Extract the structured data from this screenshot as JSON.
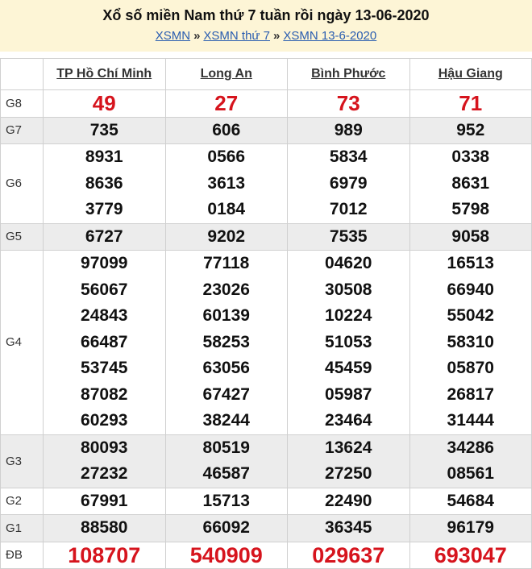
{
  "header": {
    "title": "Xổ số miền Nam thứ 7 tuần rồi ngày 13-06-2020",
    "breadcrumbs": [
      "XSMN",
      "XSMN thứ 7",
      "XSMN 13-6-2020"
    ],
    "separator": "»"
  },
  "table": {
    "provinces": [
      "TP Hồ Chí Minh",
      "Long An",
      "Bình Phước",
      "Hậu Giang"
    ],
    "prizes": [
      {
        "label": "G8",
        "results": [
          [
            "49"
          ],
          [
            "27"
          ],
          [
            "73"
          ],
          [
            "71"
          ]
        ]
      },
      {
        "label": "G7",
        "results": [
          [
            "735"
          ],
          [
            "606"
          ],
          [
            "989"
          ],
          [
            "952"
          ]
        ]
      },
      {
        "label": "G6",
        "results": [
          [
            "8931",
            "8636",
            "3779"
          ],
          [
            "0566",
            "3613",
            "0184"
          ],
          [
            "5834",
            "6979",
            "7012"
          ],
          [
            "0338",
            "8631",
            "5798"
          ]
        ]
      },
      {
        "label": "G5",
        "results": [
          [
            "6727"
          ],
          [
            "9202"
          ],
          [
            "7535"
          ],
          [
            "9058"
          ]
        ]
      },
      {
        "label": "G4",
        "results": [
          [
            "97099",
            "56067",
            "24843",
            "66487",
            "53745",
            "87082",
            "60293"
          ],
          [
            "77118",
            "23026",
            "60139",
            "58253",
            "63056",
            "67427",
            "38244"
          ],
          [
            "04620",
            "30508",
            "10224",
            "51053",
            "45459",
            "05987",
            "23464"
          ],
          [
            "16513",
            "66940",
            "55042",
            "58310",
            "05870",
            "26817",
            "31444"
          ]
        ]
      },
      {
        "label": "G3",
        "results": [
          [
            "80093",
            "27232"
          ],
          [
            "80519",
            "46587"
          ],
          [
            "13624",
            "27250"
          ],
          [
            "34286",
            "08561"
          ]
        ]
      },
      {
        "label": "G2",
        "results": [
          [
            "67991"
          ],
          [
            "15713"
          ],
          [
            "22490"
          ],
          [
            "54684"
          ]
        ]
      },
      {
        "label": "G1",
        "results": [
          [
            "88580"
          ],
          [
            "66092"
          ],
          [
            "36345"
          ],
          [
            "96179"
          ]
        ]
      },
      {
        "label": "ĐB",
        "results": [
          [
            "108707"
          ],
          [
            "540909"
          ],
          [
            "029637"
          ],
          [
            "693047"
          ]
        ]
      }
    ]
  },
  "colors": {
    "highlight": "#d6141d",
    "link": "#2a5db0",
    "header_bg": "#fdf5d6",
    "alt_row": "#ececec"
  }
}
